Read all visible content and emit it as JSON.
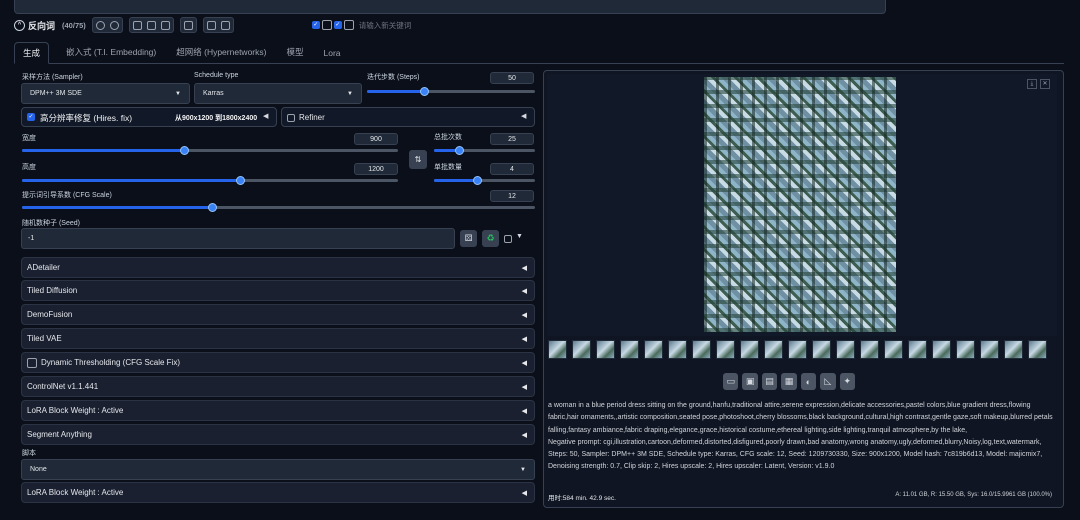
{
  "negative": {
    "title": "反向词",
    "count": "(40/75)",
    "keyword_placeholder": "请输入新关键词"
  },
  "tabs": [
    "生成",
    "嵌入式 (T.I. Embedding)",
    "超网络 (Hypernetworks)",
    "模型",
    "Lora"
  ],
  "sampler": {
    "label": "采样方法 (Sampler)",
    "value": "DPM++ 3M SDE"
  },
  "schedule": {
    "label": "Schedule type",
    "value": "Karras"
  },
  "steps": {
    "label": "迭代步数 (Steps)",
    "value": "50",
    "fraction": 0.34
  },
  "hires": {
    "label": "高分辨率修复 (Hires. fix)",
    "info": "从900x1200 到1800x2400",
    "refiner": "Refiner"
  },
  "width": {
    "label": "宽度",
    "value": "900",
    "fraction": 0.43
  },
  "height": {
    "label": "高度",
    "value": "1200",
    "fraction": 0.58
  },
  "batch_count": {
    "label": "总批次数",
    "value": "25",
    "fraction": 0.25
  },
  "batch_size": {
    "label": "单批数量",
    "value": "4",
    "fraction": 0.43
  },
  "cfg": {
    "label": "提示词引导系数 (CFG Scale)",
    "value": "12",
    "fraction": 0.37
  },
  "seed": {
    "label": "随机数种子 (Seed)",
    "value": "-1"
  },
  "accordions": {
    "adetailer": "ADetailer",
    "tiled_diffusion": "Tiled Diffusion",
    "demofusion": "DemoFusion",
    "tiled_vae": "Tiled VAE",
    "dynamic_thresholding": "Dynamic Thresholding (CFG Scale Fix)",
    "controlnet": "ControlNet v1.1.441",
    "lora_block_weight": "LoRA Block Weight : Active",
    "segment_anything": "Segment Anything"
  },
  "script": {
    "label": "脚本",
    "value": "None"
  },
  "bottom_accordion": "LoRA Block Weight : Active",
  "output": {
    "prompt": "a woman in a blue period dress sitting on the ground,hanfu,traditional attire,serene expression,delicate accessories,pastel colors,blue gradient dress,flowing fabric,hair ornaments,,artistic composition,seated pose,photoshoot,cherry blossoms,black background,cultural,high contrast,gentle gaze,soft makeup,blurred petals falling,fantasy ambiance,fabric draping,elegance,grace,historical costume,ethereal lighting,side lighting,tranquil atmosphere,by the lake,",
    "negative": "Negative prompt: cgi,illustration,cartoon,deformed,distorted,disfigured,poorly drawn,bad anatomy,wrong anatomy,ugly,deformed,blurry,Noisy,log,text,watermark,",
    "params": "Steps: 50, Sampler: DPM++ 3M SDE, Schedule type: Karras, CFG scale: 12, Seed: 1209730330, Size: 900x1200, Model hash: 7c819b6d13, Model: majicmix7, Denoising strength: 0.7, Clip skip: 2, Hires upscale: 2, Hires upscaler: Latent, Version: v1.9.0",
    "time": "用时:584 min. 42.9 sec.",
    "vram": "A: 11.01 GB, R: 15.50 GB, Sys: 16.0/15.9961 GB (100.0%)"
  },
  "colors": {
    "accent": "#2563eb",
    "background": "#0b0f19",
    "panel": "#111827"
  }
}
